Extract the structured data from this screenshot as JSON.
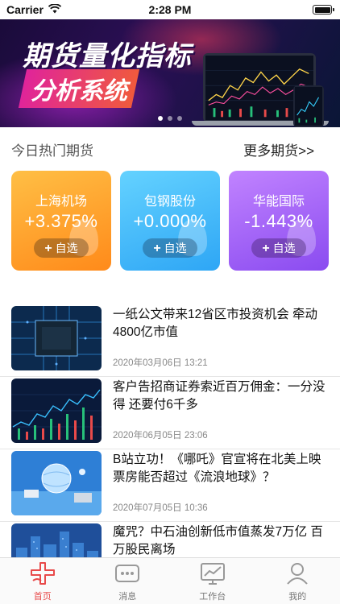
{
  "status_bar": {
    "carrier": "Carrier",
    "time": "2:28 PM"
  },
  "banner": {
    "title_line1": "期货量化指标",
    "title_line2": "分析系统",
    "page_count": 3,
    "active_page": 0
  },
  "section": {
    "title": "今日热门期货",
    "more": "更多期货>>"
  },
  "cards": [
    {
      "name": "上海机场",
      "change": "+3.375%",
      "button": "自选",
      "theme": "orange"
    },
    {
      "name": "包钢股份",
      "change": "+0.000%",
      "button": "自选",
      "theme": "blue"
    },
    {
      "name": "华能国际",
      "change": "-1.443%",
      "button": "自选",
      "theme": "purple"
    }
  ],
  "news": [
    {
      "title": "一纸公文带来12省区市投资机会 牵动4800亿市值",
      "date": "2020年03月06日 13:21",
      "thumb": "chip-image"
    },
    {
      "title": "客户告招商证券索近百万佣金：一分没得 还要付6千多",
      "date": "2020年06月05日 23:06",
      "thumb": "stock-chart-image"
    },
    {
      "title": "B站立功！《哪吒》官宣将在北美上映 票房能否超过《流浪地球》？",
      "date": "2020年07月05日 10:36",
      "thumb": "globe-image"
    },
    {
      "title": "魔咒？中石油创新低市值蒸发7万亿 百万股民离场",
      "date": "",
      "thumb": "city-image"
    }
  ],
  "tabs": [
    {
      "label": "首页",
      "icon": "home-icon",
      "active": true
    },
    {
      "label": "消息",
      "icon": "message-icon",
      "active": false
    },
    {
      "label": "工作台",
      "icon": "workbench-icon",
      "active": false
    },
    {
      "label": "我的",
      "icon": "profile-icon",
      "active": false
    }
  ],
  "colors": {
    "accent": "#e84a4a",
    "orange": "#ff8a1a",
    "blue": "#2ea6f5",
    "purple": "#8a4bf0"
  }
}
